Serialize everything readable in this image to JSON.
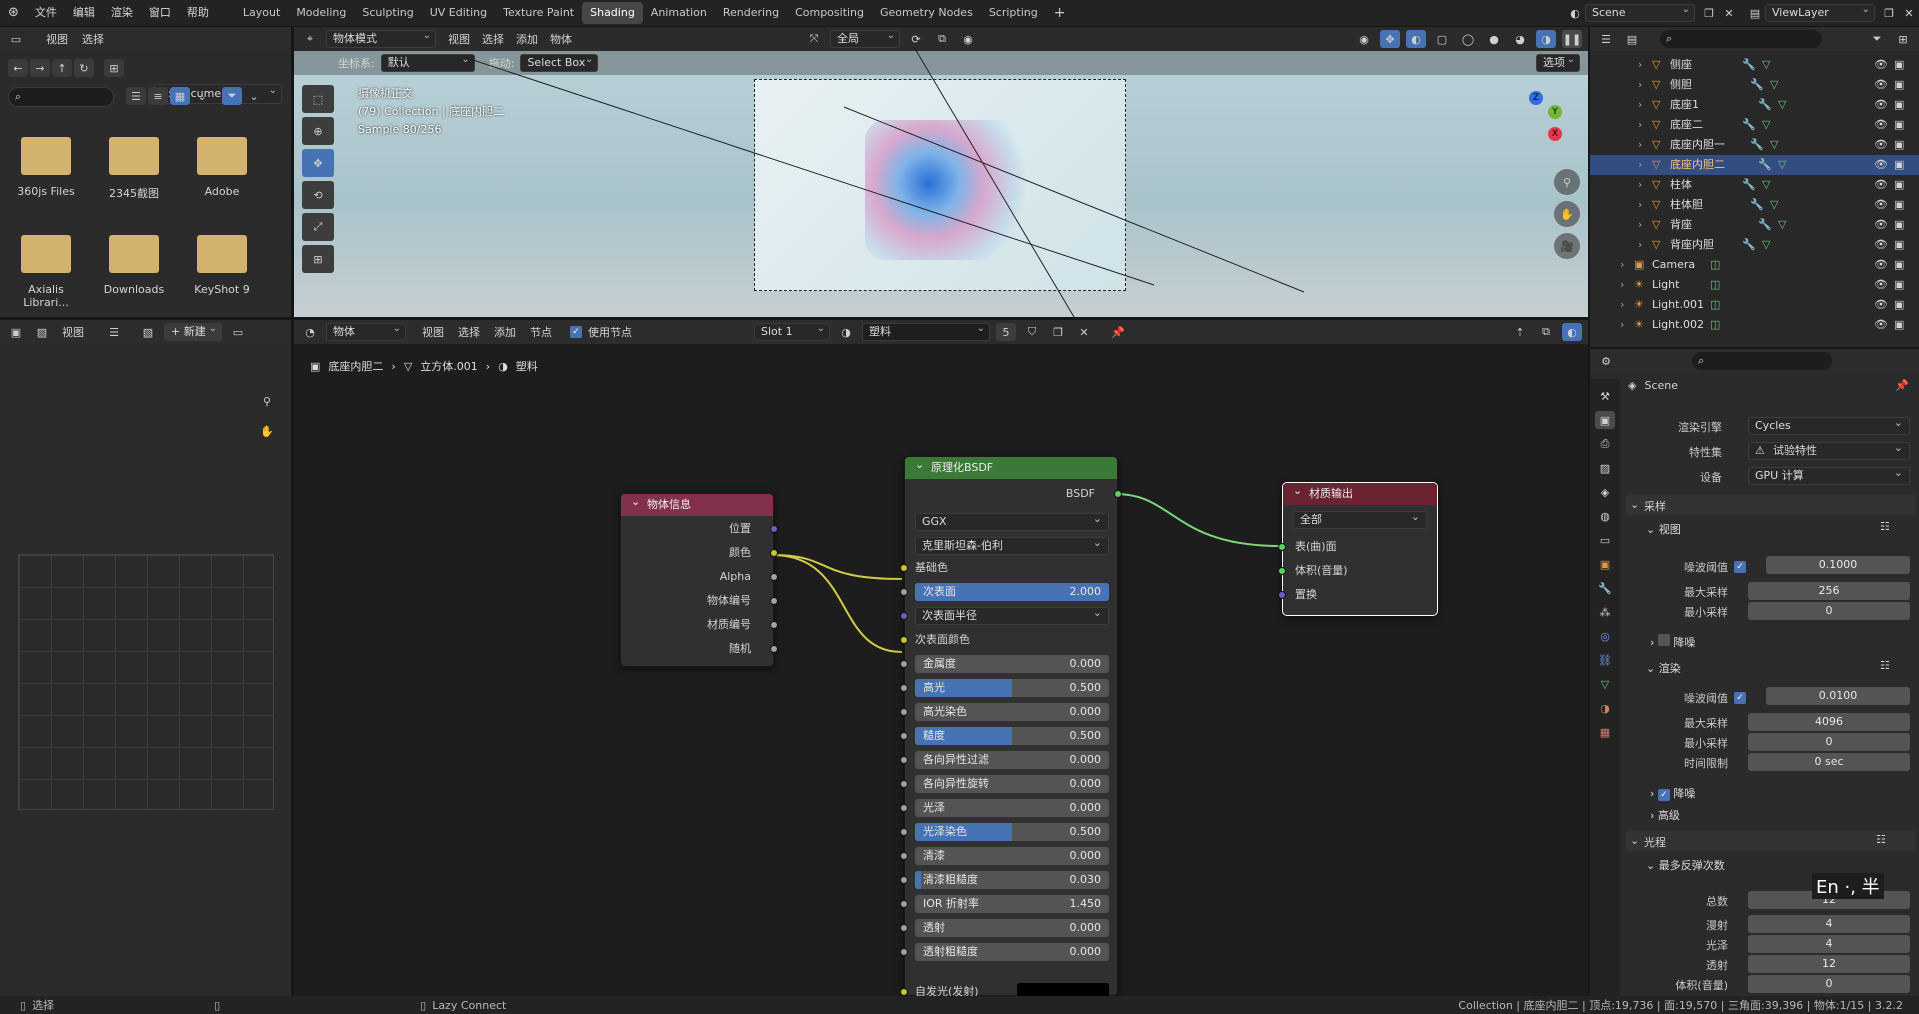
{
  "topbar": {
    "menus": [
      "文件",
      "编辑",
      "渲染",
      "窗口",
      "帮助"
    ],
    "workspaces": [
      "Layout",
      "Modeling",
      "Sculpting",
      "UV Editing",
      "Texture Paint",
      "Shading",
      "Animation",
      "Rendering",
      "Compositing",
      "Geometry Nodes",
      "Scripting"
    ],
    "active_workspace": "Shading",
    "add_tab": "+",
    "scene": "Scene",
    "view_layer": "ViewLayer"
  },
  "filebrowser": {
    "menus": [
      "视图",
      "选择"
    ],
    "path": "d:\\Documents\\",
    "items": [
      "360js Files",
      "2345截图",
      "Adobe",
      "Axialis Librari...",
      "Downloads",
      "KeyShot 9"
    ]
  },
  "viewport": {
    "mode": "物体模式",
    "menus": [
      "视图",
      "选择",
      "添加",
      "物体"
    ],
    "transform": "全局",
    "coord_label": "坐标系:",
    "coord_value": "默认",
    "drag_label": "拖动:",
    "drag_value": "Select Box",
    "options": "选项",
    "overlay_title": "摄像机正交",
    "overlay_collection": "(79) Collection | 底座内胆二",
    "overlay_sample": "Sample 80/256",
    "gizmo_axes": [
      "Z",
      "Y",
      "X"
    ]
  },
  "outliner": {
    "items": [
      {
        "name": "侧座",
        "sel": false
      },
      {
        "name": "侧胆",
        "sel": false
      },
      {
        "name": "底座1",
        "sel": false
      },
      {
        "name": "底座二",
        "sel": false
      },
      {
        "name": "底座内胆一",
        "sel": false
      },
      {
        "name": "底座内胆二",
        "sel": true
      },
      {
        "name": "柱体",
        "sel": false
      },
      {
        "name": "柱体胆",
        "sel": false
      },
      {
        "name": "背座",
        "sel": false
      },
      {
        "name": "背座内胆",
        "sel": false
      }
    ],
    "lower_items": [
      "Camera",
      "Light",
      "Light.001",
      "Light.002"
    ]
  },
  "imageeditor": {
    "menus": [
      "视图"
    ],
    "new_label": "+ 新建"
  },
  "nodeeditor": {
    "object_dd": "物体",
    "menus": [
      "视图",
      "选择",
      "添加",
      "节点"
    ],
    "use_nodes": "使用节点",
    "slot": "Slot 1",
    "material": "塑料",
    "users": "5",
    "breadcrumb": [
      "底座内胆二",
      "立方体.001",
      "塑料"
    ]
  },
  "node_objinfo": {
    "title": "物体信息",
    "outputs": [
      "位置",
      "颜色",
      "Alpha",
      "物体编号",
      "材质编号",
      "随机"
    ]
  },
  "node_bsdf": {
    "title": "原理化BSDF",
    "output": "BSDF",
    "distribution": "GGX",
    "subsurface_method": "克里斯坦森-伯利",
    "base_color": "基础色",
    "fields": [
      {
        "label": "次表面",
        "value": "2.000",
        "fill": 1.0
      },
      {
        "label": "次表面半径",
        "value": "",
        "fill": 0,
        "dropdown": true
      },
      {
        "label": "次表面颜色",
        "value": "",
        "fill": 0,
        "plain": true
      },
      {
        "label": "金属度",
        "value": "0.000",
        "fill": 0
      },
      {
        "label": "高光",
        "value": "0.500",
        "fill": 0.5
      },
      {
        "label": "高光染色",
        "value": "0.000",
        "fill": 0
      },
      {
        "label": "糙度",
        "value": "0.500",
        "fill": 0.5
      },
      {
        "label": "各向异性过滤",
        "value": "0.000",
        "fill": 0
      },
      {
        "label": "各向异性旋转",
        "value": "0.000",
        "fill": 0
      },
      {
        "label": "光泽",
        "value": "0.000",
        "fill": 0
      },
      {
        "label": "光泽染色",
        "value": "0.500",
        "fill": 0.5
      },
      {
        "label": "清漆",
        "value": "0.000",
        "fill": 0
      },
      {
        "label": "清漆粗糙度",
        "value": "0.030",
        "fill": 0.03
      },
      {
        "label": "IOR 折射率",
        "value": "1.450",
        "fill": 0
      },
      {
        "label": "透射",
        "value": "0.000",
        "fill": 0
      },
      {
        "label": "透射粗糙度",
        "value": "0.000",
        "fill": 0
      }
    ],
    "emission": "自发光(发射)"
  },
  "node_output": {
    "title": "材质输出",
    "target": "全部",
    "inputs": [
      "表(曲)面",
      "体积(音量)",
      "置换"
    ]
  },
  "properties": {
    "scene": "Scene",
    "engine_label": "渲染引擎",
    "engine": "Cycles",
    "featureset_label": "特性集",
    "featureset": "试验特性",
    "device_label": "设备",
    "device": "GPU 计算",
    "sampling": "采样",
    "viewport": "视图",
    "vp_noise_label": "噪波阈值",
    "vp_noise": "0.1000",
    "vp_max_label": "最大采样",
    "vp_max": "256",
    "vp_min_label": "最小采样",
    "vp_min": "0",
    "denoise": "降噪",
    "render": "渲染",
    "r_noise_label": "噪波阈值",
    "r_noise": "0.0100",
    "r_max_label": "最大采样",
    "r_max": "4096",
    "r_min_label": "最小采样",
    "r_min": "0",
    "r_time_label": "时间限制",
    "r_time": "0 sec",
    "denoise2": "降噪",
    "advanced": "高级",
    "lightpaths": "光程",
    "maxbounces": "最多反弹次数",
    "total_label": "总数",
    "total": "12",
    "diffuse_label": "漫射",
    "diffuse": "4",
    "glossy_label": "光泽",
    "glossy": "4",
    "trans_label": "透射",
    "trans": "12",
    "volume_label": "体积(音量)",
    "volume": "0",
    "ime": "En ·, 半"
  },
  "statusbar": {
    "select": "选择",
    "lazy": "Lazy Connect",
    "stats": "Collection | 底座内胆二 | 顶点:19,736 | 面:19,570 | 三角面:39,396 | 物体:1/15 | 3.2.2"
  }
}
